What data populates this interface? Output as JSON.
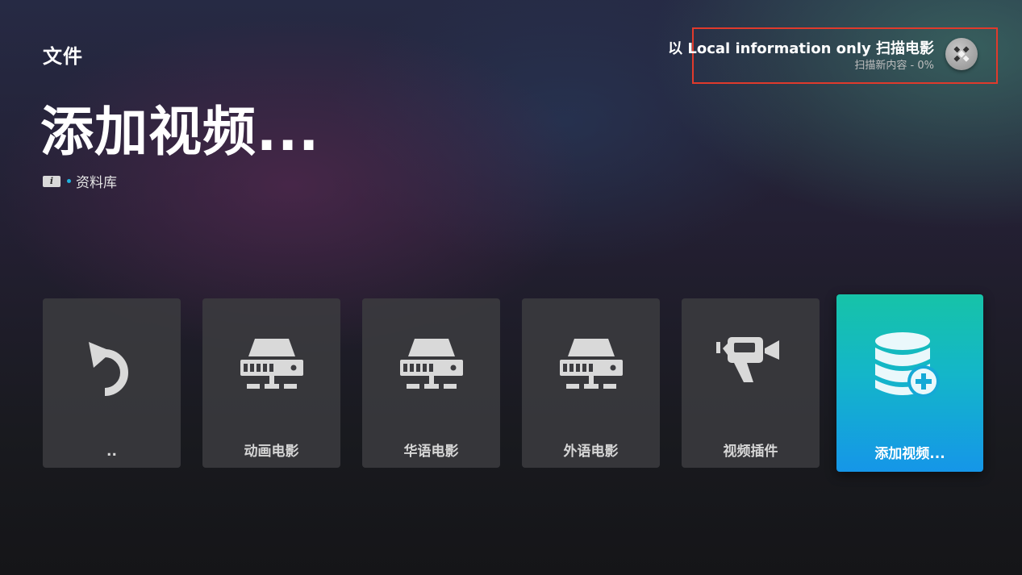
{
  "header": {
    "section_label": "文件",
    "page_title": "添加视频...",
    "breadcrumb": {
      "info_badge": "i",
      "label": "资料库"
    }
  },
  "scan_notification": {
    "title": "以 Local information only 扫描电影",
    "subtitle": "扫描新内容 - 0%",
    "progress_percent": 0,
    "icon": "kodi-logo-icon"
  },
  "tiles": [
    {
      "label": "..",
      "icon": "back-arrow-icon"
    },
    {
      "label": "动画电影",
      "icon": "network-drive-icon"
    },
    {
      "label": "华语电影",
      "icon": "network-drive-icon"
    },
    {
      "label": "外语电影",
      "icon": "network-drive-icon"
    },
    {
      "label": "视频插件",
      "icon": "video-camera-icon"
    },
    {
      "label": "添加视频...",
      "icon": "add-database-icon",
      "focused": true
    }
  ],
  "colors": {
    "focus_gradient_top": "#16c3a8",
    "focus_gradient_bottom": "#1596e8",
    "highlight_border": "#e03a2c",
    "breadcrumb_dot": "#1fb3e0"
  }
}
